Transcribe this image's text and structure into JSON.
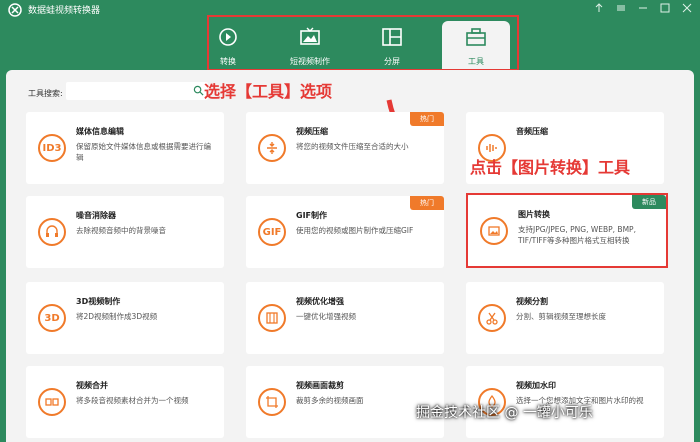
{
  "app": {
    "title": "数据蛙视频转换器"
  },
  "tabs": [
    {
      "label": "转换",
      "icon": "convert-icon"
    },
    {
      "label": "短视频制作",
      "icon": "short-video-icon"
    },
    {
      "label": "分屏",
      "icon": "split-screen-icon"
    },
    {
      "label": "工具",
      "icon": "toolbox-icon",
      "active": true
    }
  ],
  "search": {
    "label": "工具搜索:",
    "placeholder": ""
  },
  "annotations": {
    "step1": "选择【工具】选项",
    "step2": "点击【图片转换】工具"
  },
  "badges": {
    "hot": "热门",
    "new": "新品"
  },
  "tools": [
    {
      "title": "媒体信息编辑",
      "desc": "保留原始文件媒体信息或根据需要进行编辑",
      "icon": "id3-icon",
      "icon_text": "ID3"
    },
    {
      "title": "视频压缩",
      "desc": "将您的视频文件压缩至合适的大小",
      "icon": "compress-icon",
      "badge": "hot"
    },
    {
      "title": "音频压缩",
      "desc": "",
      "icon": "audio-compress-icon"
    },
    {
      "title": "噪音消除器",
      "desc": "去除视频音频中的背景噪音",
      "icon": "noise-icon"
    },
    {
      "title": "GIF制作",
      "desc": "使用您的视频或图片制作或压缩GIF",
      "icon": "gif-icon",
      "icon_text": "GIF",
      "badge": "hot"
    },
    {
      "title": "图片转换",
      "desc": "支持JPG/JPEG, PNG, WEBP, BMP, TIF/TIFF等多种图片格式互相转换",
      "icon": "image-convert-icon",
      "badge": "new"
    },
    {
      "title": "3D视频制作",
      "desc": "将2D视频制作成3D视频",
      "icon": "3d-icon",
      "icon_text": "3D"
    },
    {
      "title": "视频优化增强",
      "desc": "一键优化增强视频",
      "icon": "enhance-icon"
    },
    {
      "title": "视频分割",
      "desc": "分割、剪辑视频至理想长度",
      "icon": "scissors-icon"
    },
    {
      "title": "视频合并",
      "desc": "将多段音视频素材合并为一个视频",
      "icon": "merge-icon"
    },
    {
      "title": "视频画面裁剪",
      "desc": "裁剪多余的视频画面",
      "icon": "crop-icon"
    },
    {
      "title": "视频加水印",
      "desc": "选择一个您想添加文字和图片水印的视",
      "icon": "watermark-icon"
    }
  ],
  "watermark": "掘金技术社区 @ 一罐小可乐",
  "colors": {
    "brand": "#2d8a5e",
    "accent": "#f07a2a",
    "highlight": "#e53935"
  }
}
